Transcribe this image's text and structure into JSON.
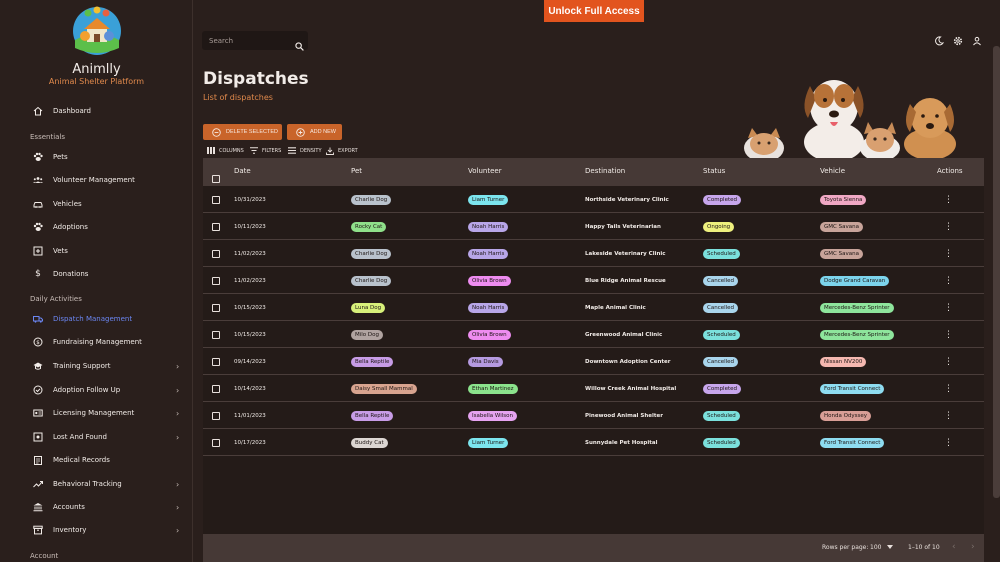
{
  "app": {
    "name": "Animlly",
    "subtitle": "Animal Shelter Platform"
  },
  "topbar": {
    "unlock_label": "Unlock Full Access",
    "search_placeholder": "Search"
  },
  "sidebar": {
    "dashboard": "Dashboard",
    "sections": {
      "essentials": "Essentials",
      "daily": "Daily Activities",
      "account": "Account"
    },
    "essentials": [
      "Pets",
      "Volunteer Management",
      "Vehicles",
      "Adoptions",
      "Vets",
      "Donations"
    ],
    "daily": [
      "Dispatch Management",
      "Fundraising Management",
      "Training Support",
      "Adoption Follow Up",
      "Licensing Management",
      "Lost And Found",
      "Medical Records",
      "Behavioral Tracking",
      "Accounts",
      "Inventory"
    ],
    "chevron": "›"
  },
  "page": {
    "title": "Dispatches",
    "subtitle": "List of dispatches"
  },
  "actions": {
    "delete": "DELETE SELECTED",
    "add": "ADD NEW"
  },
  "toolbar": {
    "columns": "COLUMNS",
    "filters": "FILTERS",
    "density": "DENSITY",
    "export": "EXPORT"
  },
  "table": {
    "headers": [
      "Date",
      "Pet",
      "Volunteer",
      "Destination",
      "Status",
      "Vehicle",
      "Actions"
    ],
    "rows": [
      {
        "date": "10/31/2023",
        "pet": "Charlie Dog",
        "volunteer": "Liam Turner",
        "destination": "Northside Veterinary Clinic",
        "status": "Completed",
        "vehicle": "Toyota Sienna"
      },
      {
        "date": "10/11/2023",
        "pet": "Rocky Cat",
        "volunteer": "Noah Harris",
        "destination": "Happy Tails Veterinarian",
        "status": "Ongoing",
        "vehicle": "GMC Savana"
      },
      {
        "date": "11/02/2023",
        "pet": "Charlie Dog",
        "volunteer": "Noah Harris",
        "destination": "Lakeside Veterinary Clinic",
        "status": "Scheduled",
        "vehicle": "GMC Savana"
      },
      {
        "date": "11/02/2023",
        "pet": "Charlie Dog",
        "volunteer": "Olivia Brown",
        "destination": "Blue Ridge Animal Rescue",
        "status": "Cancelled",
        "vehicle": "Dodge Grand Caravan"
      },
      {
        "date": "10/15/2023",
        "pet": "Luna Dog",
        "volunteer": "Noah Harris",
        "destination": "Maple Animal Clinic",
        "status": "Cancelled",
        "vehicle": "Mercedes-Benz Sprinter"
      },
      {
        "date": "10/15/2023",
        "pet": "Milo Dog",
        "volunteer": "Olivia Brown",
        "destination": "Greenwood Animal Clinic",
        "status": "Scheduled",
        "vehicle": "Mercedes-Benz Sprinter"
      },
      {
        "date": "09/14/2023",
        "pet": "Bella Reptile",
        "volunteer": "Mia Davis",
        "destination": "Downtown Adoption Center",
        "status": "Cancelled",
        "vehicle": "Nissan NV200"
      },
      {
        "date": "10/14/2023",
        "pet": "Daisy Small Mammal",
        "volunteer": "Ethan Martinez",
        "destination": "Willow Creek Animal Hospital",
        "status": "Completed",
        "vehicle": "Ford Transit Connect"
      },
      {
        "date": "11/01/2023",
        "pet": "Bella Reptile",
        "volunteer": "Isabella Wilson",
        "destination": "Pinewood Animal Shelter",
        "status": "Scheduled",
        "vehicle": "Honda Odyssey"
      },
      {
        "date": "10/17/2023",
        "pet": "Buddy Cat",
        "volunteer": "Liam Turner",
        "destination": "Sunnydale Pet Hospital",
        "status": "Scheduled",
        "vehicle": "Ford Transit Connect"
      }
    ],
    "kebab": "⋮"
  },
  "colors": {
    "pet": {
      "Charlie Dog": "#b9c2cc",
      "Rocky Cat": "#8fe08a",
      "Luna Dog": "#d7f07a",
      "Milo Dog": "#b0a3a0",
      "Bella Reptile": "#c79ce6",
      "Daisy Small Mammal": "#d8a48f",
      "Buddy Cat": "#dcd6d2"
    },
    "volunteer": {
      "Liam Turner": "#7ce5ee",
      "Noah Harris": "#b8a6e8",
      "Olivia Brown": "#ee8cf0",
      "Mia Davis": "#b59ae0",
      "Ethan Martinez": "#8be38c",
      "Isabella Wilson": "#e5a3f0"
    },
    "status": {
      "Completed": "#c7a6ec",
      "Ongoing": "#eef07e",
      "Scheduled": "#7be0dc",
      "Cancelled": "#a9d5ec"
    },
    "vehicle": {
      "Toyota Sienna": "#f0a8c4",
      "GMC Savana": "#c8a49a",
      "Dodge Grand Caravan": "#7cd4ec",
      "Mercedes-Benz Sprinter": "#8ee59c",
      "Nissan NV200": "#f5b8b0",
      "Ford Transit Connect": "#8edcf0",
      "Honda Odyssey": "#d89e96"
    }
  },
  "footer": {
    "rows_per_page_label": "Rows per page:",
    "rows_per_page_value": "100",
    "range": "1–10 of 10",
    "prev": "‹",
    "next": "›"
  }
}
